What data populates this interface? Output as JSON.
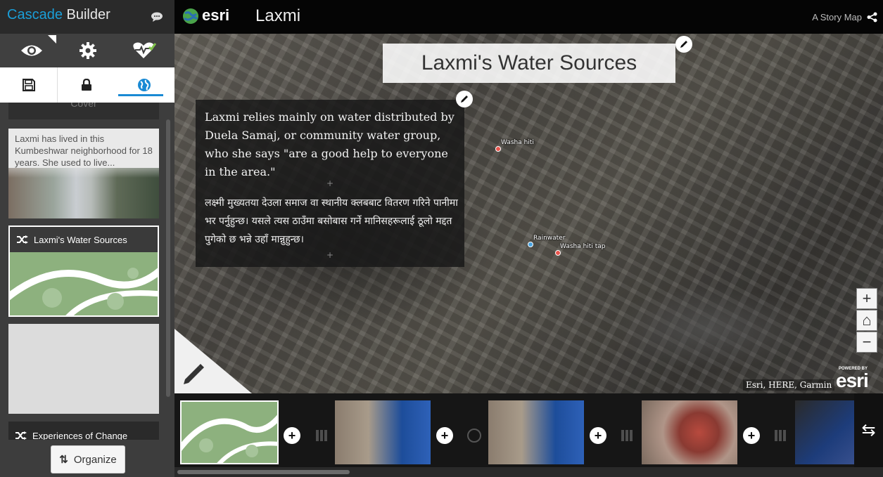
{
  "builder": {
    "title_accent": "Cascade",
    "title_rest": " Builder",
    "tools": [
      "eye-icon",
      "gear-icon",
      "health-check-icon"
    ],
    "tabs": [
      "save-icon",
      "lock-icon",
      "globe-icon"
    ],
    "active_tab": "globe",
    "sections": {
      "cover_label": "Cover",
      "card_1_text": "Laxmi has lived in this Kumbeshwar neighborhood for 18 years. She used to live...",
      "card_2_label": "Laxmi's Water Sources",
      "card_4_label": "Experiences of Change"
    },
    "organize_icon": "⇅",
    "organize_label": "Organize"
  },
  "header": {
    "logo_text": "esri",
    "story_title": "Laxmi",
    "storymap_link": "A Story Map"
  },
  "map": {
    "title": "Laxmi's Water Sources",
    "panel_en": "Laxmi relies mainly on water distributed by Duela Samaj, or community water group, who she says \"are a good help to everyone in the area.\"",
    "panel_ne": "लक्ष्मी मुख्यतया देउला समाज वा स्थानीय क्लबबाट वितरण गरिने पानीमा भर पर्नुहुन्छ। यसले त्यस ठाउँमा बसोबास गर्ने मानिसहरूलाई ठूलो मद्दत पुगेको छ भन्ने उहाँ मान्नुहुन्छ।",
    "separator": "+",
    "markers": {
      "washa_hiti": "Washa hiti",
      "rainwater": "Rainwater",
      "washa_hiti_tap": "Washa hiti tap"
    },
    "marker_colors": {
      "red": "#e8544c",
      "blue": "#4aa3e0"
    },
    "zoom": {
      "in": "+",
      "home": "⌂",
      "out": "−"
    },
    "attribution": "Esri, HERE, Garmin",
    "powered_by": "POWERED BY",
    "esri_wordmark": "esri"
  },
  "carousel": {
    "add_symbol": "+",
    "swap_icon": "⇆"
  },
  "colors": {
    "accent": "#1a9fd9",
    "map_green": "#8db17e"
  }
}
